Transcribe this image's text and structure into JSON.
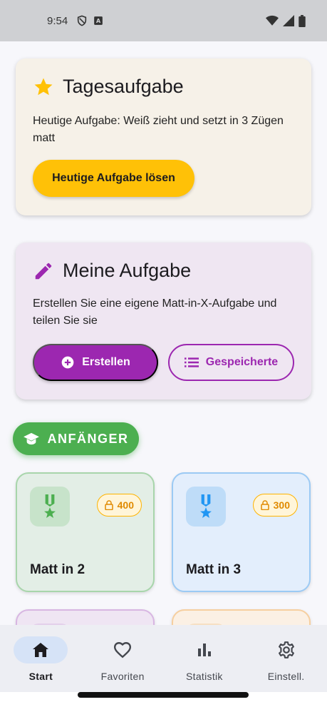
{
  "status_bar": {
    "time": "9:54",
    "left_icons": [
      "shield-icon",
      "a-notification-icon"
    ],
    "right_icons": [
      "wifi-icon",
      "signal-icon",
      "battery-icon"
    ]
  },
  "daily_task": {
    "icon": "star-icon",
    "title": "Tagesaufgabe",
    "description": "Heutige Aufgabe: Weiß zieht und setzt in 3 Zügen matt",
    "button_label": "Heutige Aufgabe lösen",
    "accent_color": "#ffc107"
  },
  "my_task": {
    "icon": "pencil-icon",
    "title": "Meine Aufgabe",
    "description": "Erstellen Sie eine eigene Matt-in-X-Aufgabe und teilen Sie sie",
    "create_label": "Erstellen",
    "saved_label": "Gespeicherte",
    "accent_color": "#9c27b0"
  },
  "level_section": {
    "icon": "graduation-cap-icon",
    "label": "ANFÄNGER",
    "color": "#4caf50"
  },
  "levels": [
    {
      "name": "Matt in 2",
      "lock_value": "400",
      "color": "#4caf50"
    },
    {
      "name": "Matt in 3",
      "lock_value": "300",
      "color": "#2196f3"
    },
    {
      "name": "",
      "lock_value": "",
      "color": "#9c27b0"
    },
    {
      "name": "",
      "lock_value": "",
      "color": "#ff9800"
    }
  ],
  "bottom_nav": {
    "items": [
      {
        "label": "Start",
        "icon": "home-icon",
        "active": true
      },
      {
        "label": "Favoriten",
        "icon": "heart-icon",
        "active": false
      },
      {
        "label": "Statistik",
        "icon": "bar-chart-icon",
        "active": false
      },
      {
        "label": "Einstell.",
        "icon": "gear-icon",
        "active": false
      }
    ]
  }
}
